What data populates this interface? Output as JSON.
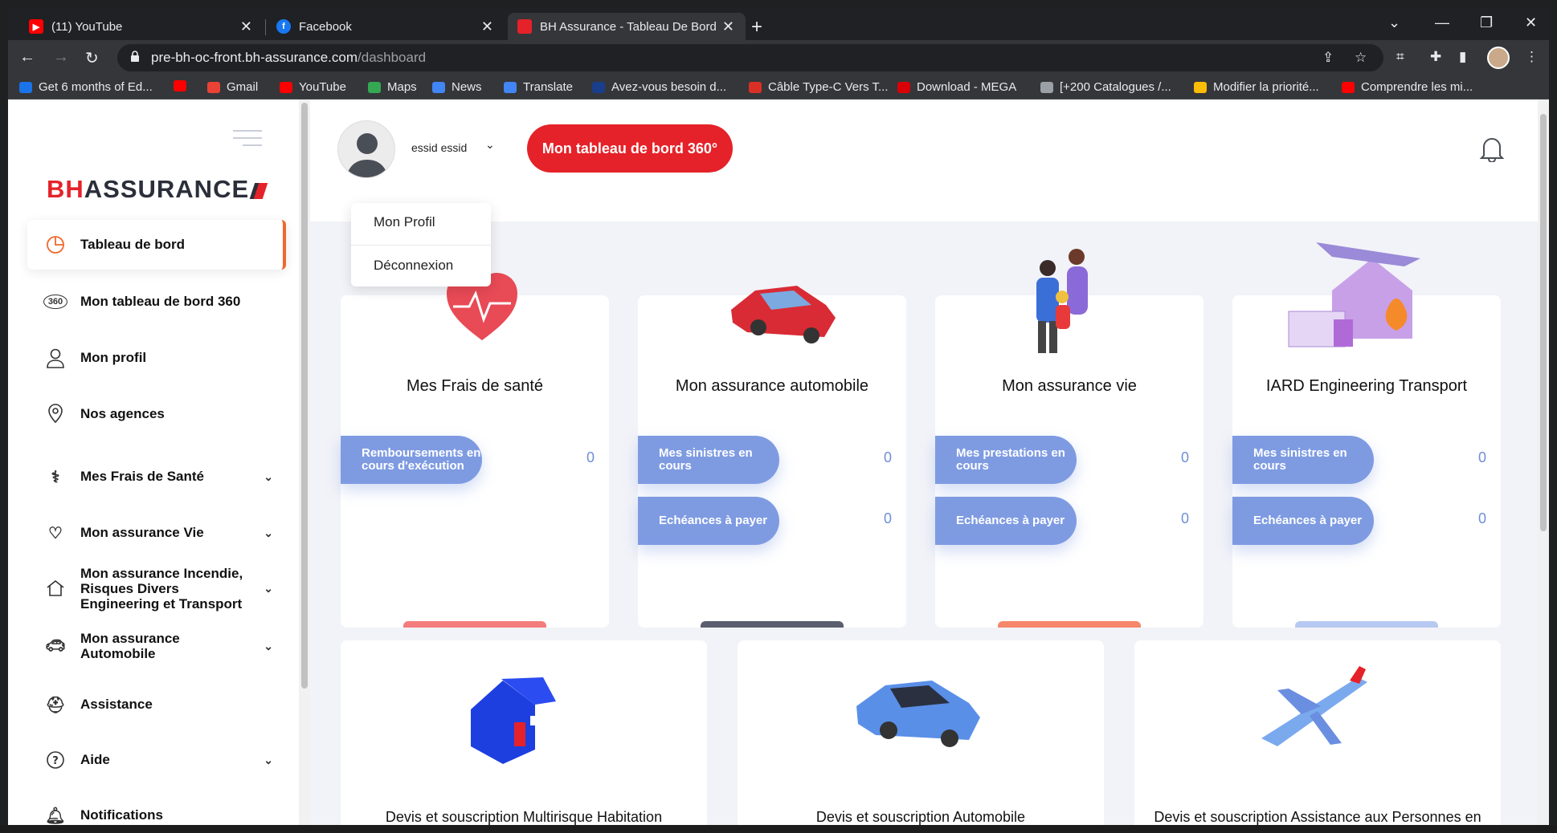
{
  "browser": {
    "tabs": [
      {
        "label": "(11) YouTube"
      },
      {
        "label": "Facebook"
      },
      {
        "label": "BH Assurance - Tableau De Bord"
      }
    ],
    "url_host": "pre-bh-oc-front.bh-assurance.com",
    "url_path": "/dashboard",
    "bookmarks": [
      {
        "label": "Get 6 months of Ed...",
        "color": "#1a73e8"
      },
      {
        "label": "",
        "color": "#ff0000"
      },
      {
        "label": "Gmail",
        "color": "#ea4335"
      },
      {
        "label": "YouTube",
        "color": "#ff0000"
      },
      {
        "label": "Maps",
        "color": "#34a853"
      },
      {
        "label": "News",
        "color": "#4285f4"
      },
      {
        "label": "Translate",
        "color": "#4285f4"
      },
      {
        "label": "Avez-vous besoin d...",
        "color": "#1a3e8c"
      },
      {
        "label": "Câble Type-C Vers T...",
        "color": "#d93025"
      },
      {
        "label": "Download - MEGA",
        "color": "#d90007"
      },
      {
        "label": "[+200 Catalogues /...",
        "color": "#9aa0a6"
      },
      {
        "label": "Modifier la priorité...",
        "color": "#fbbc04"
      },
      {
        "label": "Comprendre les mi...",
        "color": "#ff0000"
      }
    ]
  },
  "brand": {
    "bh": "BH",
    "rest": "ASSURANCE"
  },
  "sidebar": {
    "items": [
      {
        "label": "Tableau de bord",
        "icon": "pie-chart-icon"
      },
      {
        "label": "Mon tableau de bord 360",
        "icon": "360-view-icon"
      },
      {
        "label": "Mon profil",
        "icon": "user-icon"
      },
      {
        "label": "Nos agences",
        "icon": "location-pin-icon"
      },
      {
        "label": "Mes Frais de Santé",
        "icon": "health-hands-icon"
      },
      {
        "label": "Mon assurance Vie",
        "icon": "life-hands-icon"
      },
      {
        "label": "Mon assurance Incendie, Risques Divers Engineering et Transport",
        "icon": "home-icon"
      },
      {
        "label": "Mon assurance Automobile",
        "icon": "car-icon"
      },
      {
        "label": "Assistance",
        "icon": "assistance-icon"
      },
      {
        "label": "Aide",
        "icon": "help-icon"
      },
      {
        "label": "Notifications",
        "icon": "bell-icon"
      }
    ]
  },
  "header": {
    "username": "essid essid",
    "cta": "Mon tableau de bord 360°",
    "dropdown": [
      "Mon Profil",
      "Déconnexion"
    ]
  },
  "cards": [
    {
      "title": "Mes Frais de santé",
      "bar_color": "#f47c7c",
      "rows": [
        {
          "label": "Remboursements en cours d'exécution",
          "value": "0"
        }
      ]
    },
    {
      "title": "Mon assurance automobile",
      "bar_color": "#5b5e6e",
      "rows": [
        {
          "label": "Mes sinistres en cours",
          "value": "0"
        },
        {
          "label": "Echéances à payer",
          "value": "0"
        }
      ]
    },
    {
      "title": "Mon assurance vie",
      "bar_color": "#f6876a",
      "rows": [
        {
          "label": "Mes prestations en cours",
          "value": "0"
        },
        {
          "label": "Echéances à payer",
          "value": "0"
        }
      ]
    },
    {
      "title": "IARD Engineering Transport",
      "bar_color": "#b7c9f1",
      "rows": [
        {
          "label": "Mes sinistres en cours",
          "value": "0"
        },
        {
          "label": "Echéances à payer",
          "value": "0"
        }
      ]
    }
  ],
  "quotes": [
    {
      "title": "Devis et souscription Multirisque Habitation"
    },
    {
      "title": "Devis et souscription Automobile"
    },
    {
      "title": "Devis et souscription Assistance aux Personnes en Voyage"
    }
  ]
}
